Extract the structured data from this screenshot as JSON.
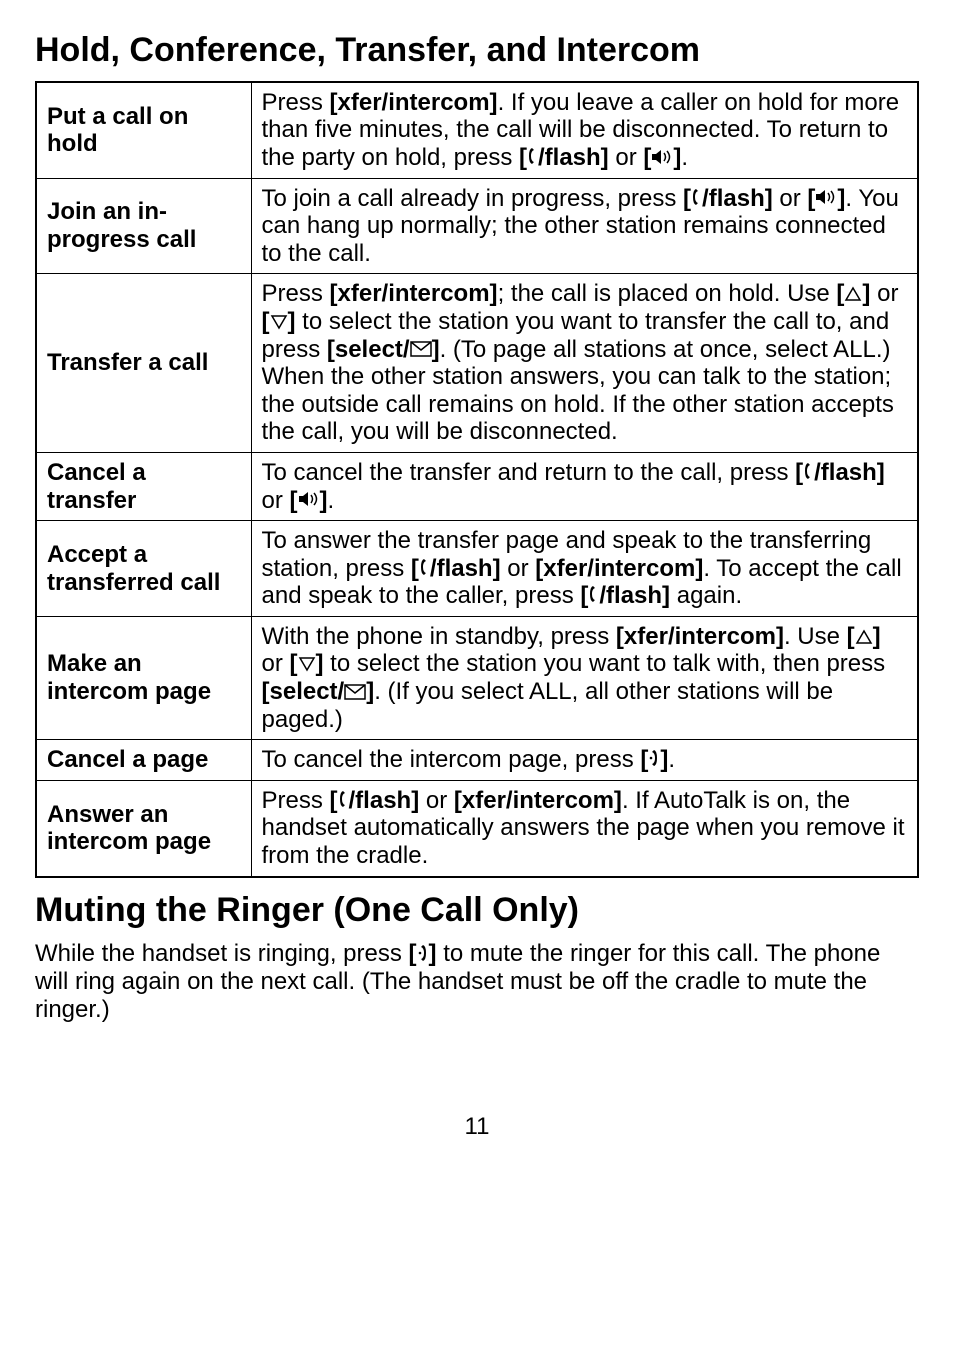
{
  "heading_1": "Hold, Conference, Transfer, and Intercom",
  "heading_2": "Muting the Ringer (One Call Only)",
  "table": [
    {
      "label": "Put a call on hold",
      "content": "Press <b>[xfer/intercom]</b>. If you leave a caller on hold for more than five minutes, the call will be disconnected. To return to the party on hold, press <b>[{talk}/flash]</b> or <b>[{speaker}]</b>."
    },
    {
      "label": "Join an in-progress call",
      "content": "To join a call already in progress, press <b>[{talk}/flash]</b> or <b>[{speaker}]</b>. You can hang up normally; the other station remains connected to the call."
    },
    {
      "label": "Transfer a call",
      "content": "Press <b>[xfer/intercom]</b>; the call is placed on hold. Use <b>[{up}]</b> or <b>[{down}]</b> to select the station you want to transfer the call to, and press <b>[select/{env}]</b>. (To page all stations at once, select ALL.) When the other station answers, you can talk to the station; the outside call remains on hold. If the other station accepts the call, you will be disconnected."
    },
    {
      "label": "Cancel a transfer",
      "content": "To cancel the transfer and return to the call, press <b>[{talk}/flash]</b> or <b>[{speaker}]</b>."
    },
    {
      "label": "Accept a transferred call",
      "content": "To answer the transfer page and speak to the transferring station, press <b>[{talk}/flash]</b> or <b>[xfer/intercom]</b>. To accept the call and speak to the caller, press <b>[{talk}/flash]</b> again."
    },
    {
      "label": "Make an intercom page",
      "content": "With the phone in standby, press <b>[xfer/intercom]</b>. Use <b>[{up}]</b> or <b>[{down}]</b> to select the station you want to talk with, then press <b>[select/{env}]</b>. (If you select ALL, all other stations will be paged.)"
    },
    {
      "label": "Cancel a page",
      "content": "To cancel the intercom page, press <b>[{end}]</b>."
    },
    {
      "label": "Answer an intercom page",
      "content": "Press <b>[{talk}/flash]</b> or <b>[xfer/intercom]</b>. If AutoTalk is on, the handset  automatically answers the page when you remove it from the cradle."
    }
  ],
  "muting_paragraph": "While the handset is ringing, press <b>[{end}]</b> to mute the ringer for this call. The phone will ring again on the next call. (The handset must be off the cradle to mute the ringer.)",
  "page_number": "11",
  "icons": {
    "talk": "<svg width='11' height='20' viewBox='0 0 11 20'><path d='M5 2 Q2 3 2 10 Q2 17 5 18 L7 16 Q4 15 4 10 Q4 5 7 4 Z' fill='black'/></svg>",
    "speaker": "<svg width='22' height='18' viewBox='0 0 22 18'><rect x='1' y='6' width='4' height='6' fill='black'/><path d='M5 6 L10 2 L10 16 L5 12 Z' fill='black'/><path d='M13 5 Q16 9 13 13' stroke='black' stroke-width='1.5' fill='none'/><path d='M16 3 Q21 9 16 15' stroke='black' stroke-width='1.5' fill='none'/></svg>",
    "up": "<svg width='18' height='16' viewBox='0 0 18 16'><path d='M9 2 L16 14 L2 14 Z' fill='none' stroke='black' stroke-width='1.5'/></svg>",
    "down": "<svg width='18' height='16' viewBox='0 0 18 16'><path d='M9 14 L16 2 L2 2 Z' fill='none' stroke='black' stroke-width='1.5'/></svg>",
    "env": "<svg width='22' height='16' viewBox='0 0 22 16'><rect x='1' y='1' width='20' height='14' fill='none' stroke='black' stroke-width='1.5'/><path d='M1 1 L11 9 L21 1' fill='none' stroke='black' stroke-width='1.5'/></svg>",
    "end": "<svg width='12' height='20' viewBox='0 0 12 20'><path d='M6 2 Q9 3 9 10 Q9 17 6 18 L4 16 Q7 15 7 10 Q7 5 4 4 Z' fill='black'/><circle cx='3' cy='10' r='1.3' fill='black'/></svg>"
  }
}
